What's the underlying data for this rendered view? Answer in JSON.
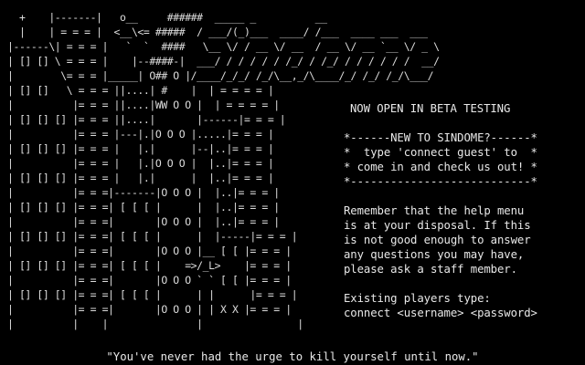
{
  "terminal": {
    "background": "#000000",
    "foreground": "#e6e6e6"
  },
  "ascii_art": "  +    |-------|   o__     ######  _____ _          __\n  |    | = = = |  <__\\<= #####  / ___/(_)___  ____/ /___  ____ ___  ___\n|------\\| = = = |   `  `  ####   \\__ \\/ / __ \\/ __  / __ \\/ __ `__ \\/ _ \\\n| [] [] \\ = = = |    |--####-|  ___/ / / / / / /_/ / /_/ / / / / / /  __/\n|        \\= = = |_____| O## O |/____/_/_/ /_/\\__,_/\\____/_/ /_/ /_/\\___/\n| [] []   \\ = = = ||....| #    |  | = = = = |\n|          |= = = ||....|WW O O |  | = = = = |\n| [] [] [] |= = = ||....|       |------|= = = |\n|          |= = = |---|.|O O O |.....|= = = |\n| [] [] [] |= = = |   |.|      |--|..|= = = |\n|          |= = = |   |.|O O O |  |..|= = = |\n| [] [] [] |= = = |   |.|      |  |..|= = = |\n|          |= = =|-------|O O O |  |..|= = = |\n| [] [] [] |= = =| [ [ [ |      |  |..|= = = |\n|          |= = =|       |O O O |  |..|= = = |\n| [] [] [] |= = =| [ [ [ |      |  |-----|= = = |\n|          |= = =|       |O O O |__ [ [ |= = = |\n| [] [] [] |= = =| [ [ [ |    =>/_L>    |= = = |\n|          |= = =|       |O O O ` ` [ [ |= = = |\n| [] [] [] |= = =| [ [ [ |      | |      |= = = |\n|          |= = =|       |O O O | | X X |= = = |\n|          |    |               |                |",
  "announcement": "NOW OPEN IN BETA TESTING",
  "welcome_box": [
    "*------NEW TO SINDOME?------*",
    "*  type 'connect guest' to  *",
    "* come in and check us out! *",
    "*---------------------------*"
  ],
  "help_text": [
    "Remember that the help menu",
    "is at your disposal. If this",
    "is not good enough to answer",
    "any questions you may have,",
    "please ask a staff member."
  ],
  "login_info": [
    "Existing players type:",
    "connect <username> <password>"
  ],
  "quote": "\"You've never had the urge to kill yourself until now.\""
}
